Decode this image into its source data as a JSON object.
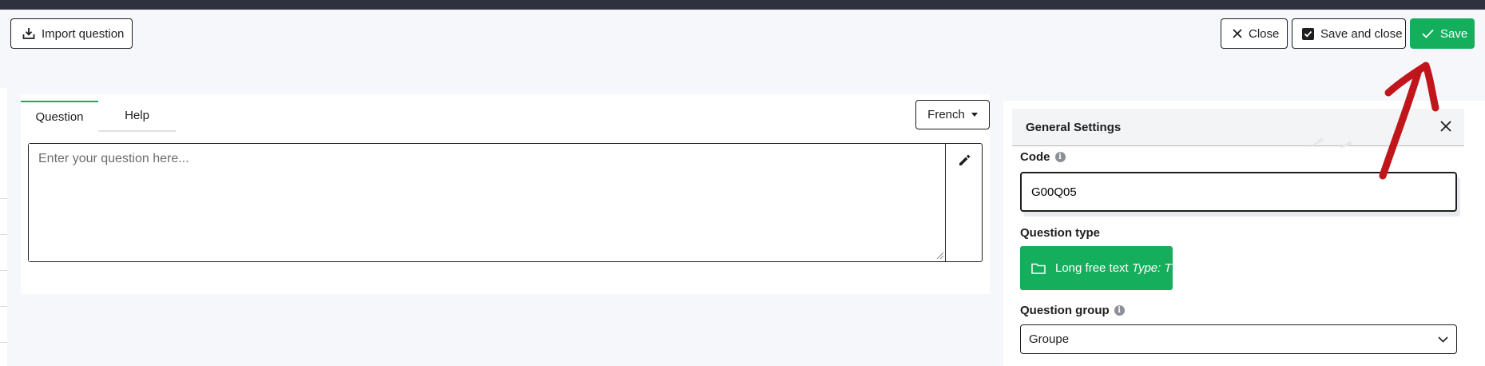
{
  "toolbar": {
    "import_label": "Import question",
    "close_label": "Close",
    "save_and_close_label": "Save and close",
    "save_label": "Save"
  },
  "editor": {
    "tabs": [
      {
        "label": "Question",
        "active": true
      },
      {
        "label": "Help",
        "active": false
      }
    ],
    "language": "French",
    "question_placeholder": "Enter your question here...",
    "question_value": ""
  },
  "settings": {
    "title": "General Settings",
    "code_label": "Code",
    "code_value": "G00Q05",
    "question_type_label": "Question type",
    "question_type_name": "Long free text",
    "question_type_code": "Type: T",
    "question_group_label": "Question group",
    "question_group_value": "Groupe"
  },
  "colors": {
    "accent": "#14ae5c",
    "topbar": "#2f323e",
    "annotation": "#c0151b"
  },
  "icons": {
    "import": "download-tray-icon",
    "close": "x-icon",
    "save_and_close": "checkbox-icon",
    "save": "check-icon",
    "edit": "pencil-icon",
    "question_type": "folder-icon",
    "info": "info-icon",
    "dropdown": "chevron-down-icon"
  }
}
